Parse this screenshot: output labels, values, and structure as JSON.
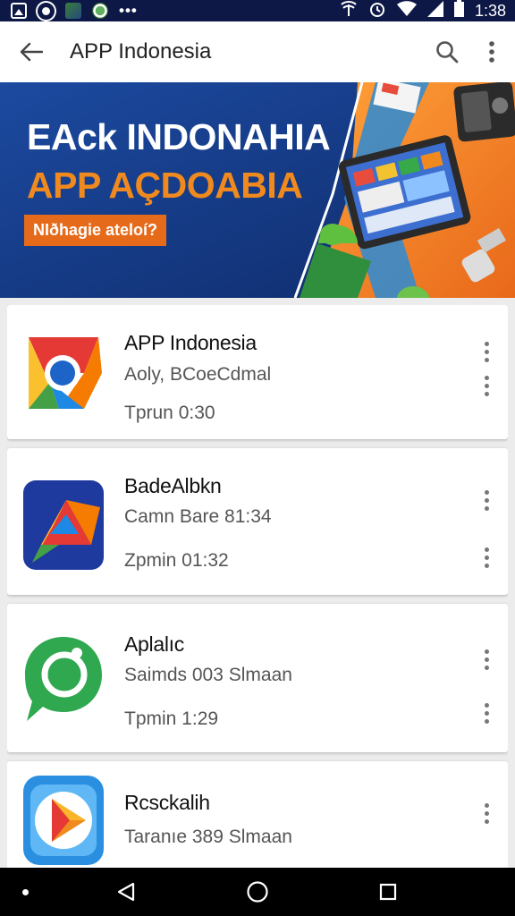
{
  "status_bar": {
    "time": "1:38",
    "left_icons": [
      "gallery-icon",
      "circle-icon",
      "app-icon",
      "app-icon",
      "more-icon"
    ],
    "right_icons": [
      "signal-icon",
      "alarm-icon",
      "wifi-icon",
      "cellular-icon",
      "battery-icon"
    ]
  },
  "app_bar": {
    "title": "APP Indonesia",
    "back_icon": "arrow-back-icon",
    "search_icon": "search-icon",
    "more_icon": "more-vert-icon"
  },
  "banner": {
    "title": "EAck INDONAHIA",
    "subtitle": "APP AÇDOABIA",
    "tag": "NIðhagie ateloí?"
  },
  "apps": [
    {
      "name": "APP Indonesia",
      "subtitle": "Aoly, BCoeCdmal",
      "time": "Tprun 0:30",
      "icon": "chrome-like-icon"
    },
    {
      "name": "BadeAlbkn",
      "subtitle": "Camn Bare 81:34",
      "time": "Zpmin 01:32",
      "icon": "triangle-logo-icon"
    },
    {
      "name": "Aplalıc",
      "subtitle": "Saimds 003 Slmaan",
      "time": "Tpmin 1:29",
      "icon": "chat-bubble-icon"
    },
    {
      "name": "Rcsckalih",
      "subtitle": "Taranıe 389 Slmaan",
      "time": "",
      "icon": "play-store-icon"
    }
  ],
  "nav_bar": {
    "back_icon": "nav-back-icon",
    "home_icon": "nav-home-icon",
    "recents_icon": "nav-recents-icon"
  },
  "colors": {
    "status_bar": "#0d1846",
    "banner_blue": "#163b86",
    "banner_orange": "#f08a1e",
    "tag_orange": "#e56b1b"
  }
}
